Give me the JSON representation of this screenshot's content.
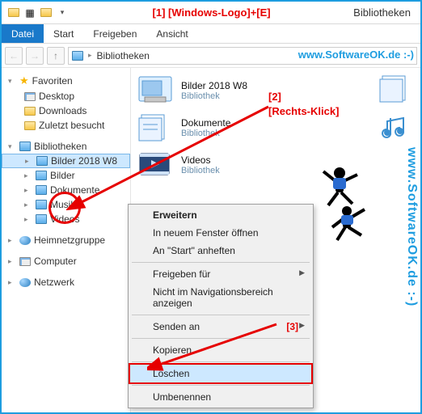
{
  "titlebar": {
    "annotation": "[1]  [Windows-Logo]+[E]",
    "window_title": "Bibliotheken"
  },
  "ribbon": {
    "file": "Datei",
    "tabs": [
      "Start",
      "Freigeben",
      "Ansicht"
    ]
  },
  "breadcrumb": {
    "root": "Bibliotheken"
  },
  "watermark": "www.SoftwareOK.de :-)",
  "tree": {
    "favorites": {
      "label": "Favoriten",
      "items": [
        "Desktop",
        "Downloads",
        "Zuletzt besucht"
      ]
    },
    "libraries": {
      "label": "Bibliotheken",
      "items": [
        "Bilder 2018 W8",
        "Bilder",
        "Dokumente",
        "Musik",
        "Videos"
      ]
    },
    "homegroup": {
      "label": "Heimnetzgruppe"
    },
    "computer": {
      "label": "Computer"
    },
    "network": {
      "label": "Netzwerk"
    }
  },
  "content": {
    "items": [
      {
        "title": "Bilder 2018 W8",
        "subtitle": "Bibliothek",
        "icon": "pictures"
      },
      {
        "title": "Dokumente",
        "subtitle": "Bibliothek",
        "icon": "documents"
      },
      {
        "title": "Videos",
        "subtitle": "Bibliothek",
        "icon": "videos"
      }
    ],
    "side_icons": [
      "documents",
      "music"
    ]
  },
  "annot2": {
    "num": "[2]",
    "text": "[Rechts-Klick]"
  },
  "annot3": "[3]",
  "context_menu": {
    "items": [
      {
        "label": "Erweitern",
        "bold": true
      },
      {
        "label": "In neuem Fenster öffnen"
      },
      {
        "label": "An \"Start\" anheften"
      },
      {
        "sep": true
      },
      {
        "label": "Freigeben für",
        "submenu": true
      },
      {
        "label": "Nicht im Navigationsbereich anzeigen"
      },
      {
        "sep": true
      },
      {
        "label": "Senden an",
        "submenu": true
      },
      {
        "sep": true
      },
      {
        "label": "Kopieren"
      },
      {
        "sep": true
      },
      {
        "label": "Löschen",
        "highlight": true,
        "boxed": true
      },
      {
        "sep": true
      },
      {
        "label": "Umbenennen"
      }
    ]
  }
}
